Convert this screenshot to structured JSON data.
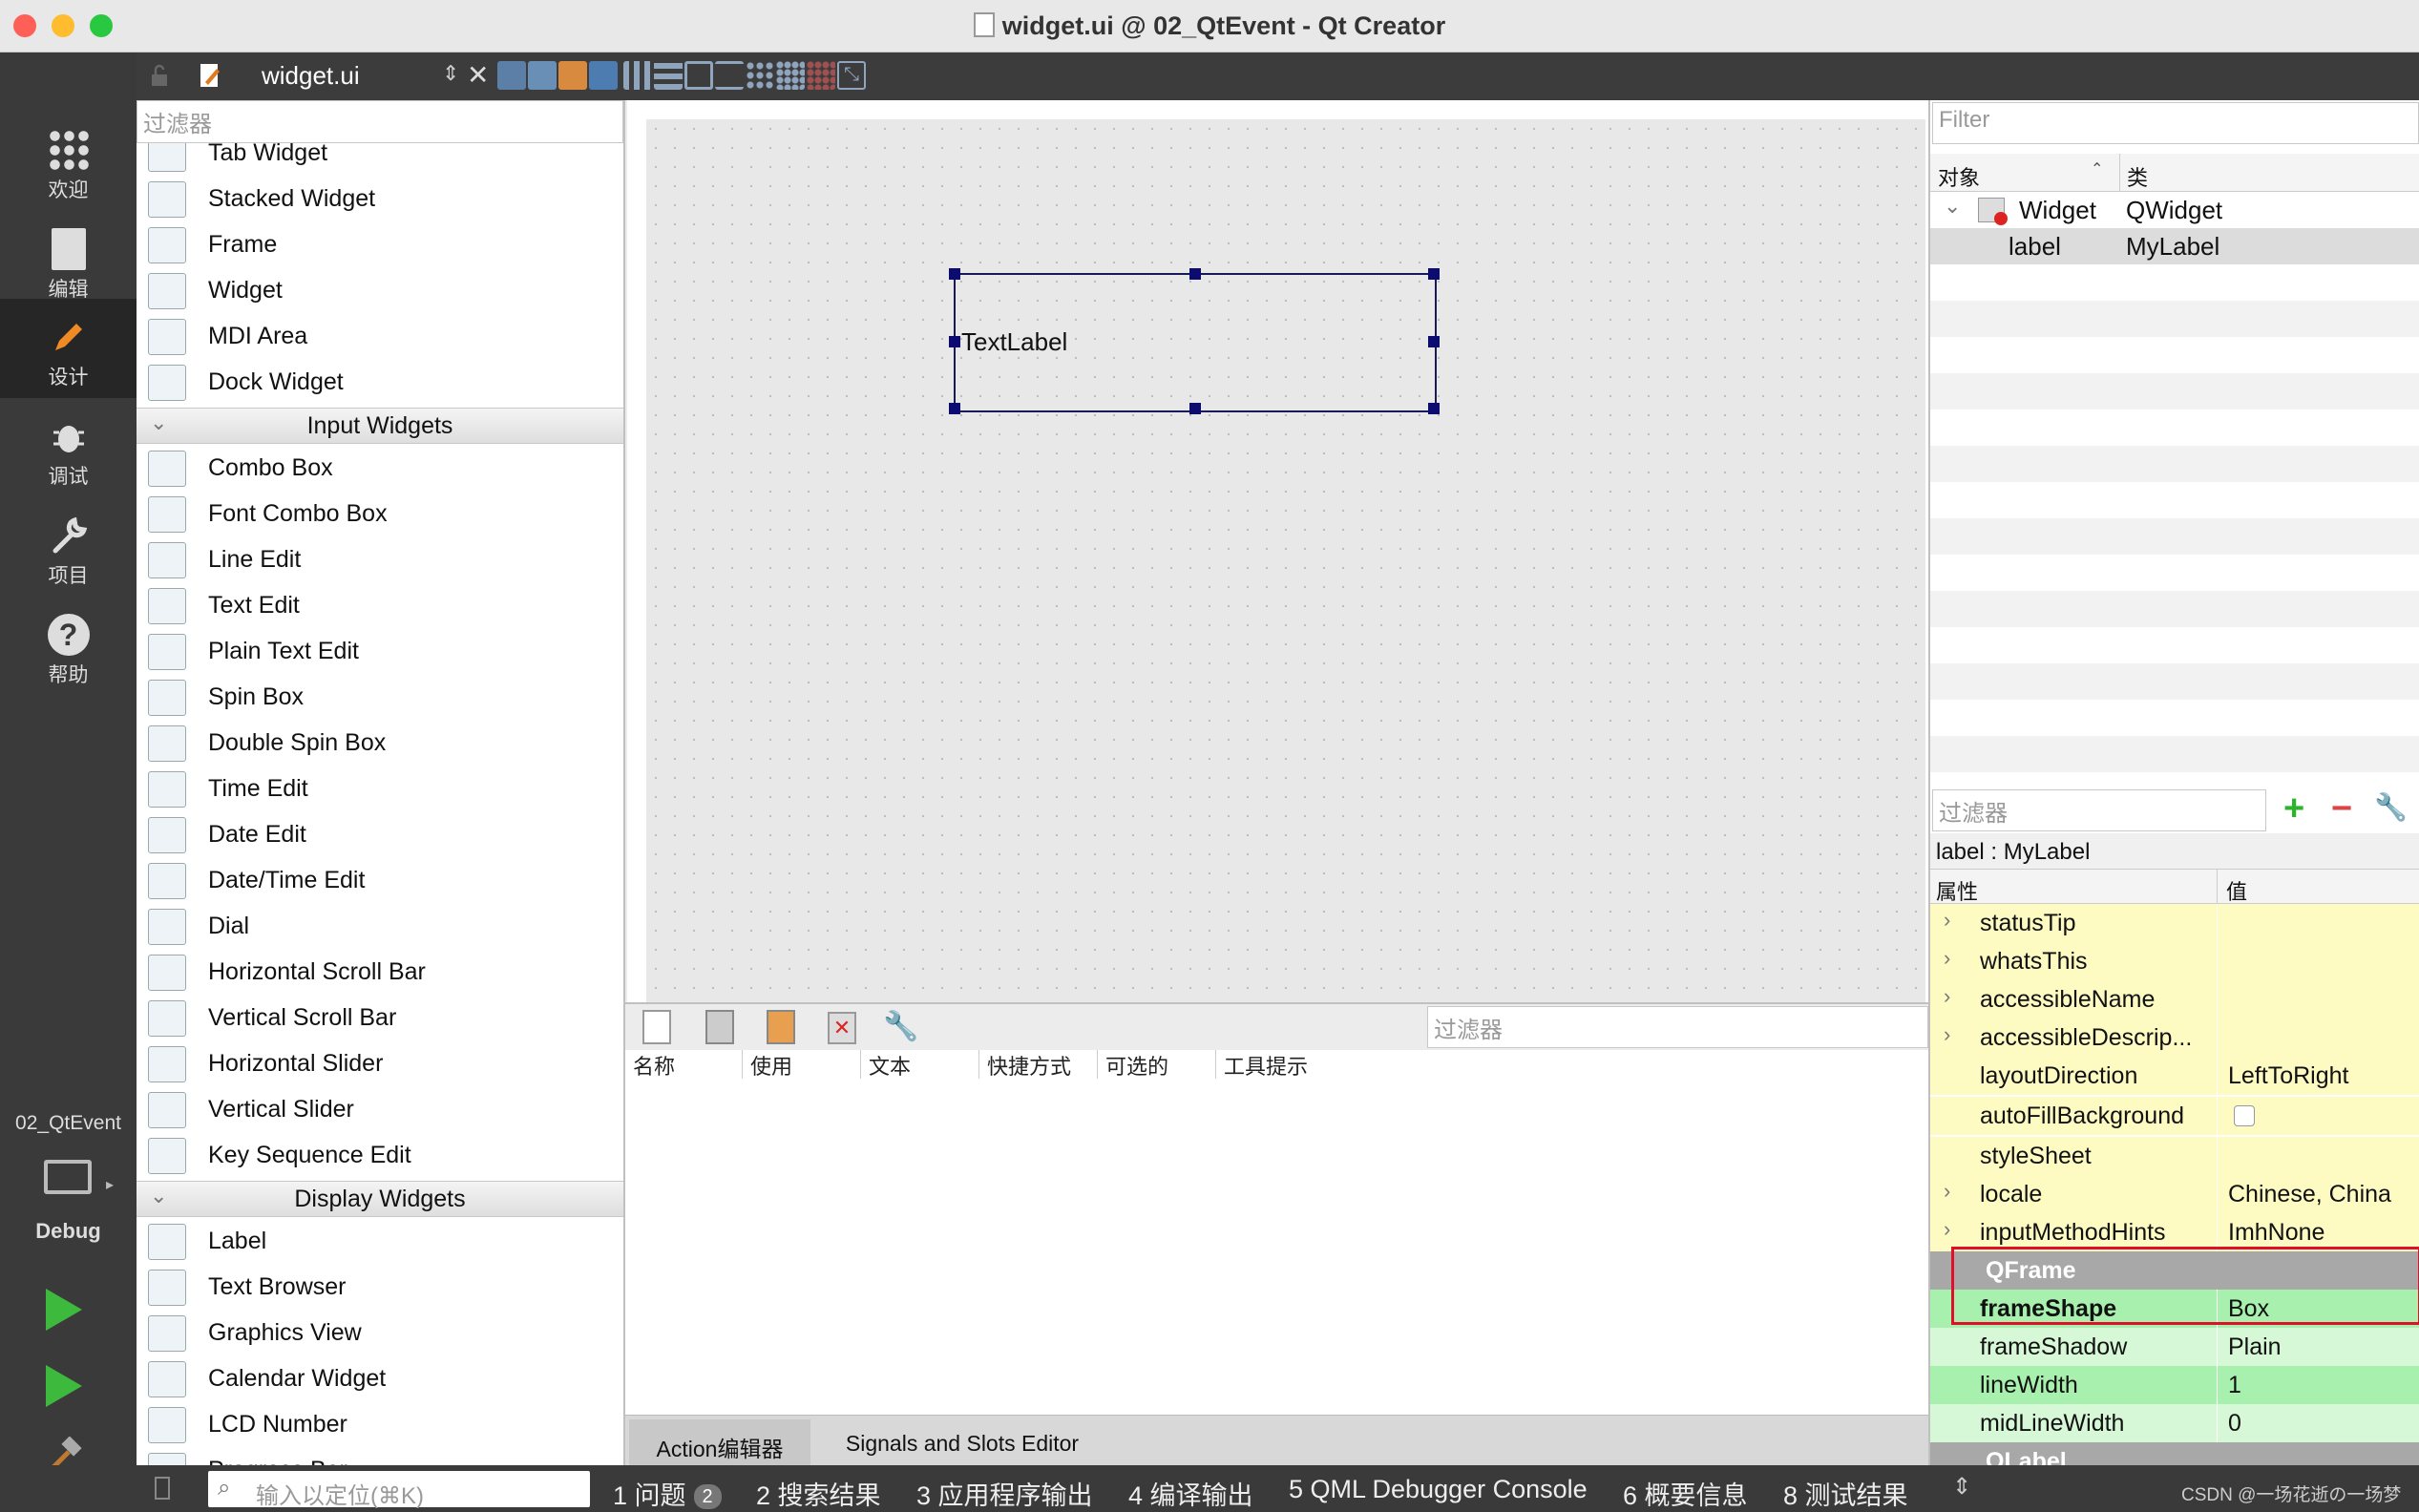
{
  "window": {
    "title": "widget.ui @ 02_QtEvent - Qt Creator"
  },
  "editor_toolbar": {
    "file_name": "widget.ui"
  },
  "modes": [
    {
      "label": "欢迎",
      "icon": "grid-icon"
    },
    {
      "label": "编辑",
      "icon": "document-icon"
    },
    {
      "label": "设计",
      "icon": "pencil-icon"
    },
    {
      "label": "调试",
      "icon": "bug-icon"
    },
    {
      "label": "项目",
      "icon": "wrench-icon"
    },
    {
      "label": "帮助",
      "icon": "help-icon"
    }
  ],
  "kit": {
    "project": "02_QtEvent",
    "build": "Debug"
  },
  "widget_box": {
    "filter_placeholder": "过滤器",
    "container_items": [
      "Tab Widget",
      "Stacked Widget",
      "Frame",
      "Widget",
      "MDI Area",
      "Dock Widget"
    ],
    "input_category": "Input Widgets",
    "input_items": [
      "Combo Box",
      "Font Combo Box",
      "Line Edit",
      "Text Edit",
      "Plain Text Edit",
      "Spin Box",
      "Double Spin Box",
      "Time Edit",
      "Date Edit",
      "Date/Time Edit",
      "Dial",
      "Horizontal Scroll Bar",
      "Vertical Scroll Bar",
      "Horizontal Slider",
      "Vertical Slider",
      "Key Sequence Edit"
    ],
    "display_category": "Display Widgets",
    "display_items": [
      "Label",
      "Text Browser",
      "Graphics View",
      "Calendar Widget",
      "LCD Number",
      "Progress Bar"
    ]
  },
  "form": {
    "label_text": "TextLabel"
  },
  "action_editor": {
    "filter_placeholder": "过滤器",
    "columns": [
      "名称",
      "使用",
      "文本",
      "快捷方式",
      "可选的",
      "工具提示"
    ],
    "tabs": [
      "Action编辑器",
      "Signals and Slots Editor"
    ]
  },
  "object_inspector": {
    "filter_placeholder": "Filter",
    "col_object": "对象",
    "col_class": "类",
    "rows": [
      {
        "object": "Widget",
        "class": "QWidget"
      },
      {
        "object": "label",
        "class": "MyLabel"
      }
    ]
  },
  "property_editor": {
    "filter_placeholder": "过滤器",
    "subject": "label : MyLabel",
    "col_property": "属性",
    "col_value": "值",
    "rows": [
      {
        "name": "statusTip",
        "value": ""
      },
      {
        "name": "whatsThis",
        "value": ""
      },
      {
        "name": "accessibleName",
        "value": ""
      },
      {
        "name": "accessibleDescrip...",
        "value": ""
      },
      {
        "name": "layoutDirection",
        "value": "LeftToRight"
      },
      {
        "name": "autoFillBackground",
        "value": ""
      },
      {
        "name": "styleSheet",
        "value": ""
      },
      {
        "name": "locale",
        "value": "Chinese, China"
      },
      {
        "name": "inputMethodHints",
        "value": "ImhNone"
      }
    ],
    "qframe_group": "QFrame",
    "qframe_rows": [
      {
        "name": "frameShape",
        "value": "Box"
      },
      {
        "name": "frameShadow",
        "value": "Plain"
      },
      {
        "name": "lineWidth",
        "value": "1"
      },
      {
        "name": "midLineWidth",
        "value": "0"
      }
    ],
    "qlabel_group": "QLabel"
  },
  "status_bar": {
    "locator_placeholder": "输入以定位(⌘K)",
    "panes": [
      "1 问题",
      "2 搜索结果",
      "3 应用程序输出",
      "4 编译输出",
      "5 QML Debugger Console",
      "6 概要信息",
      "8 测试结果"
    ],
    "issues_count": "2",
    "watermark": "CSDN @一场花逝の一场梦"
  },
  "colors": {
    "property_yellow": "#fdfbc2",
    "property_green": "#a8f0ae",
    "property_green_light": "#d6f8d6",
    "highlight_box": "#e0102a"
  }
}
